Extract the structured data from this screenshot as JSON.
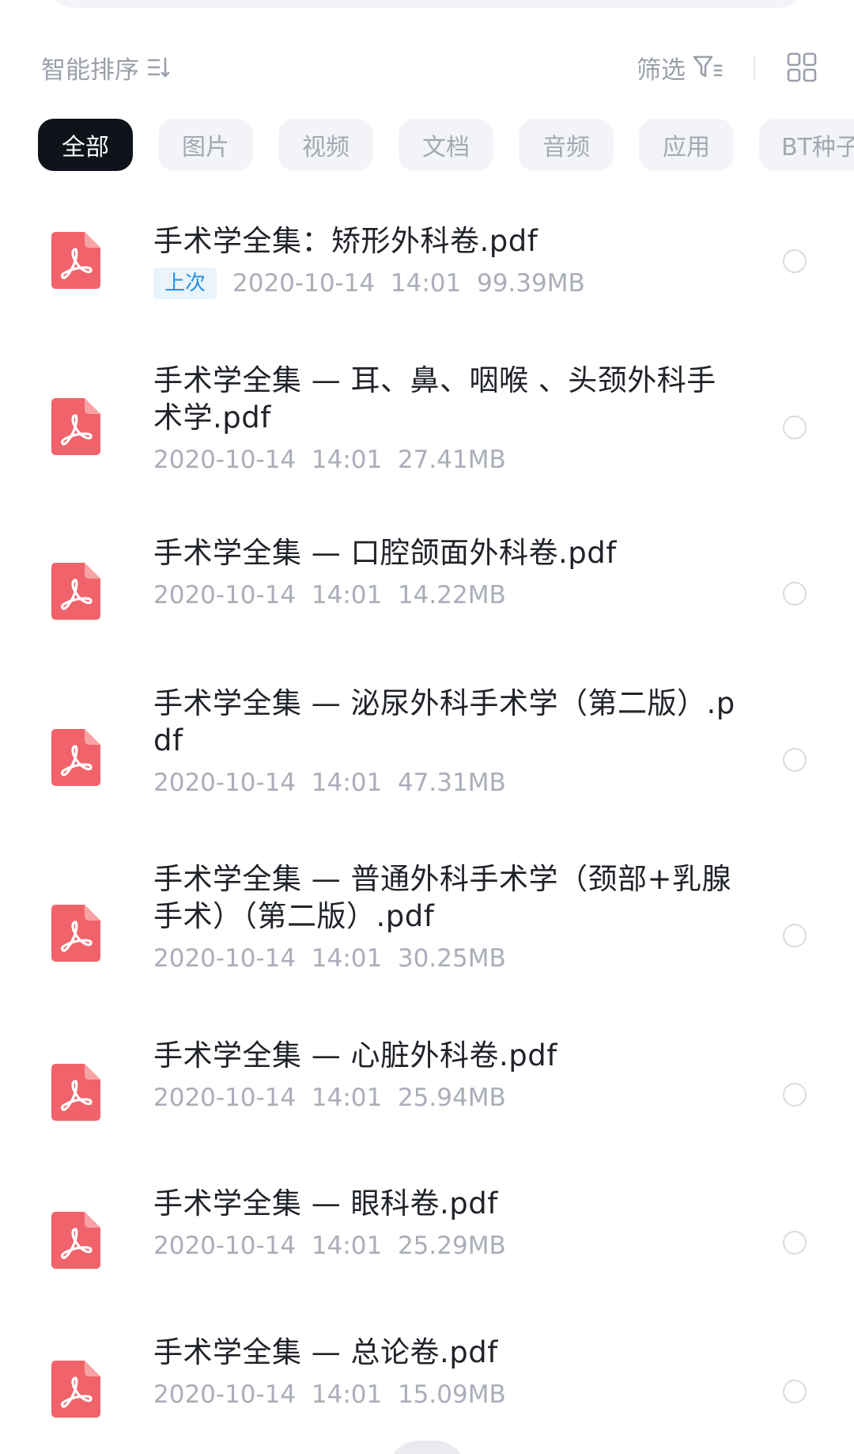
{
  "toolbar": {
    "sort_label": "智能排序",
    "filter_label": "筛选"
  },
  "tabs": [
    {
      "label": "全部",
      "active": true
    },
    {
      "label": "图片",
      "active": false
    },
    {
      "label": "视频",
      "active": false
    },
    {
      "label": "文档",
      "active": false
    },
    {
      "label": "音频",
      "active": false
    },
    {
      "label": "应用",
      "active": false
    },
    {
      "label": "BT种子",
      "active": false
    }
  ],
  "files": [
    {
      "name": "手术学全集：矫形外科卷.pdf",
      "badge": "上次",
      "date": "2020-10-14",
      "time": "14:01",
      "size": "99.39MB"
    },
    {
      "name": "手术学全集 — 耳、鼻、咽喉 、头颈外科手术学.pdf",
      "badge": "",
      "date": "2020-10-14",
      "time": "14:01",
      "size": "27.41MB"
    },
    {
      "name": "手术学全集 — 口腔颌面外科卷.pdf",
      "badge": "",
      "date": "2020-10-14",
      "time": "14:01",
      "size": "14.22MB"
    },
    {
      "name": "手术学全集 — 泌尿外科手术学（第二版）.pdf",
      "badge": "",
      "date": "2020-10-14",
      "time": "14:01",
      "size": "47.31MB"
    },
    {
      "name": "手术学全集 — 普通外科手术学（颈部+乳腺手术）（第二版）.pdf",
      "badge": "",
      "date": "2020-10-14",
      "time": "14:01",
      "size": "30.25MB"
    },
    {
      "name": "手术学全集 — 心脏外科卷.pdf",
      "badge": "",
      "date": "2020-10-14",
      "time": "14:01",
      "size": "25.94MB"
    },
    {
      "name": "手术学全集 — 眼科卷.pdf",
      "badge": "",
      "date": "2020-10-14",
      "time": "14:01",
      "size": "25.29MB"
    },
    {
      "name": "手术学全集 — 总论卷.pdf",
      "badge": "",
      "date": "2020-10-14",
      "time": "14:01",
      "size": "15.09MB"
    }
  ],
  "colors": {
    "pdf_icon": "#f0636a",
    "active_tab": "#0f131a",
    "badge_text": "#2a8fe0",
    "meta_text": "#a9aeb8"
  },
  "icons": {
    "file_type": "pdf-icon",
    "sort": "sort-icon",
    "filter": "filter-icon",
    "view": "grid-view-icon",
    "select": "radio-icon"
  }
}
